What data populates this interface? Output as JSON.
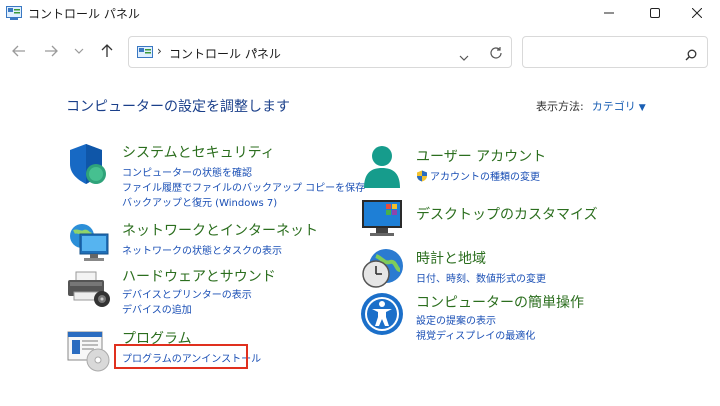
{
  "window": {
    "title": "コントロール パネル",
    "minimize_icon": "minimize-icon",
    "maximize_icon": "maximize-icon",
    "close_icon": "close-icon"
  },
  "nav": {
    "breadcrumb": "コントロール パネル",
    "separator": "›",
    "search_placeholder": ""
  },
  "main": {
    "heading": "コンピューターの設定を調整します",
    "view_by_label": "表示方法:",
    "view_by_value": "カテゴリ",
    "left_categories": [
      {
        "title": "システムとセキュリティ",
        "icon": "security-shield-icon",
        "links": [
          "コンピューターの状態を確認",
          "ファイル履歴でファイルのバックアップ コピーを保存",
          "バックアップと復元 (Windows 7)"
        ]
      },
      {
        "title": "ネットワークとインターネット",
        "icon": "network-globe-icon",
        "links": [
          "ネットワークの状態とタスクの表示"
        ]
      },
      {
        "title": "ハードウェアとサウンド",
        "icon": "printer-icon",
        "links": [
          "デバイスとプリンターの表示",
          "デバイスの追加"
        ]
      },
      {
        "title": "プログラム",
        "icon": "programs-disc-icon",
        "links": [
          "プログラムのアンインストール"
        ]
      }
    ],
    "right_categories": [
      {
        "title": "ユーザー アカウント",
        "icon": "user-account-icon",
        "links": [
          "アカウントの種類の変更"
        ]
      },
      {
        "title": "デスクトップのカスタマイズ",
        "icon": "desktop-monitor-icon",
        "links": []
      },
      {
        "title": "時計と地域",
        "icon": "clock-globe-icon",
        "links": [
          "日付、時刻、数値形式の変更"
        ]
      },
      {
        "title": "コンピューターの簡単操作",
        "icon": "accessibility-icon",
        "links": [
          "設定の提案の表示",
          "視覚ディスプレイの最適化"
        ]
      }
    ]
  },
  "colors": {
    "heading": "#1a3f8a",
    "category_title": "#2b6e1e",
    "link": "#1a4fb5",
    "highlight_border": "#e0301e"
  }
}
